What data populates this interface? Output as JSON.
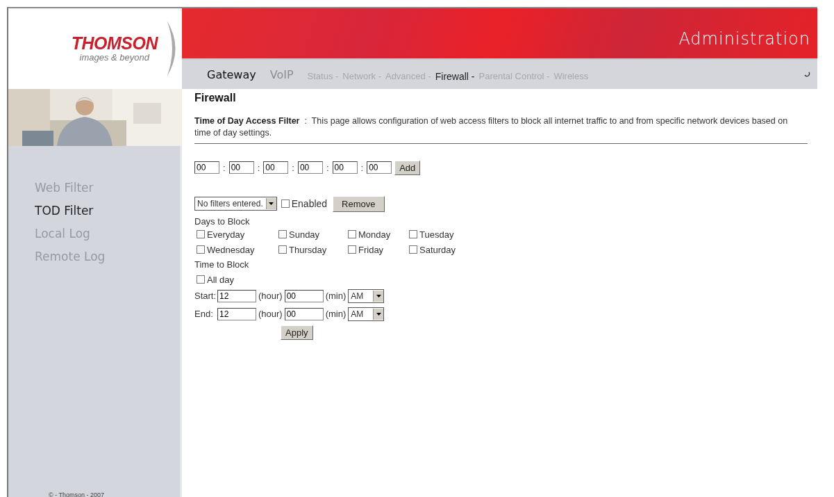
{
  "header": {
    "brand": "THOMSON",
    "tagline": "images & beyond",
    "title": "Administration"
  },
  "main_tabs": [
    {
      "label": "Gateway",
      "selected": true
    },
    {
      "label": "VoIP",
      "selected": false
    }
  ],
  "sub_nav": [
    {
      "label": "Status -",
      "selected": false
    },
    {
      "label": "Network -",
      "selected": false
    },
    {
      "label": "Advanced -",
      "selected": false
    },
    {
      "label": "Firewall -",
      "selected": true
    },
    {
      "label": "Parental Control -",
      "selected": false
    },
    {
      "label": "Wireless",
      "selected": false
    }
  ],
  "sidebar": {
    "items": [
      {
        "label": "Web Filter",
        "selected": false
      },
      {
        "label": "TOD Filter",
        "selected": true
      },
      {
        "label": "Local Log",
        "selected": false
      },
      {
        "label": "Remote Log",
        "selected": false
      }
    ],
    "copyright": "© - Thomson - 2007"
  },
  "page": {
    "heading": "Firewall",
    "intro_title": "Time of Day Access Filter",
    "intro_sep": ":",
    "intro_text": "This page allows configuration of web access filters to block all internet traffic to and from specific network devices based on time of day settings."
  },
  "mac_fields": [
    "00",
    "00",
    "00",
    "00",
    "00",
    "00"
  ],
  "mac_separator": ":",
  "add_button": "Add",
  "filter_select": "No filters entered.",
  "enabled": {
    "label": "Enabled",
    "checked": false
  },
  "remove_button": "Remove",
  "days_label": "Days to Block",
  "days": [
    {
      "label": "Everyday",
      "checked": false
    },
    {
      "label": "Sunday",
      "checked": false
    },
    {
      "label": "Monday",
      "checked": false
    },
    {
      "label": "Tuesday",
      "checked": false
    },
    {
      "label": "Wednesday",
      "checked": false
    },
    {
      "label": "Thursday",
      "checked": false
    },
    {
      "label": "Friday",
      "checked": false
    },
    {
      "label": "Saturday",
      "checked": false
    }
  ],
  "time_label": "Time to Block",
  "all_day": {
    "label": "All day",
    "checked": false
  },
  "times": [
    {
      "label": "Start:",
      "hour": "12",
      "hour_unit": "(hour)",
      "minute": "00",
      "minute_unit": "(min)",
      "ampm": "AM"
    },
    {
      "label": "End:",
      "hour": "12",
      "hour_unit": "(hour)",
      "minute": "00",
      "minute_unit": "(min)",
      "ampm": "AM"
    }
  ],
  "apply_button": "Apply"
}
